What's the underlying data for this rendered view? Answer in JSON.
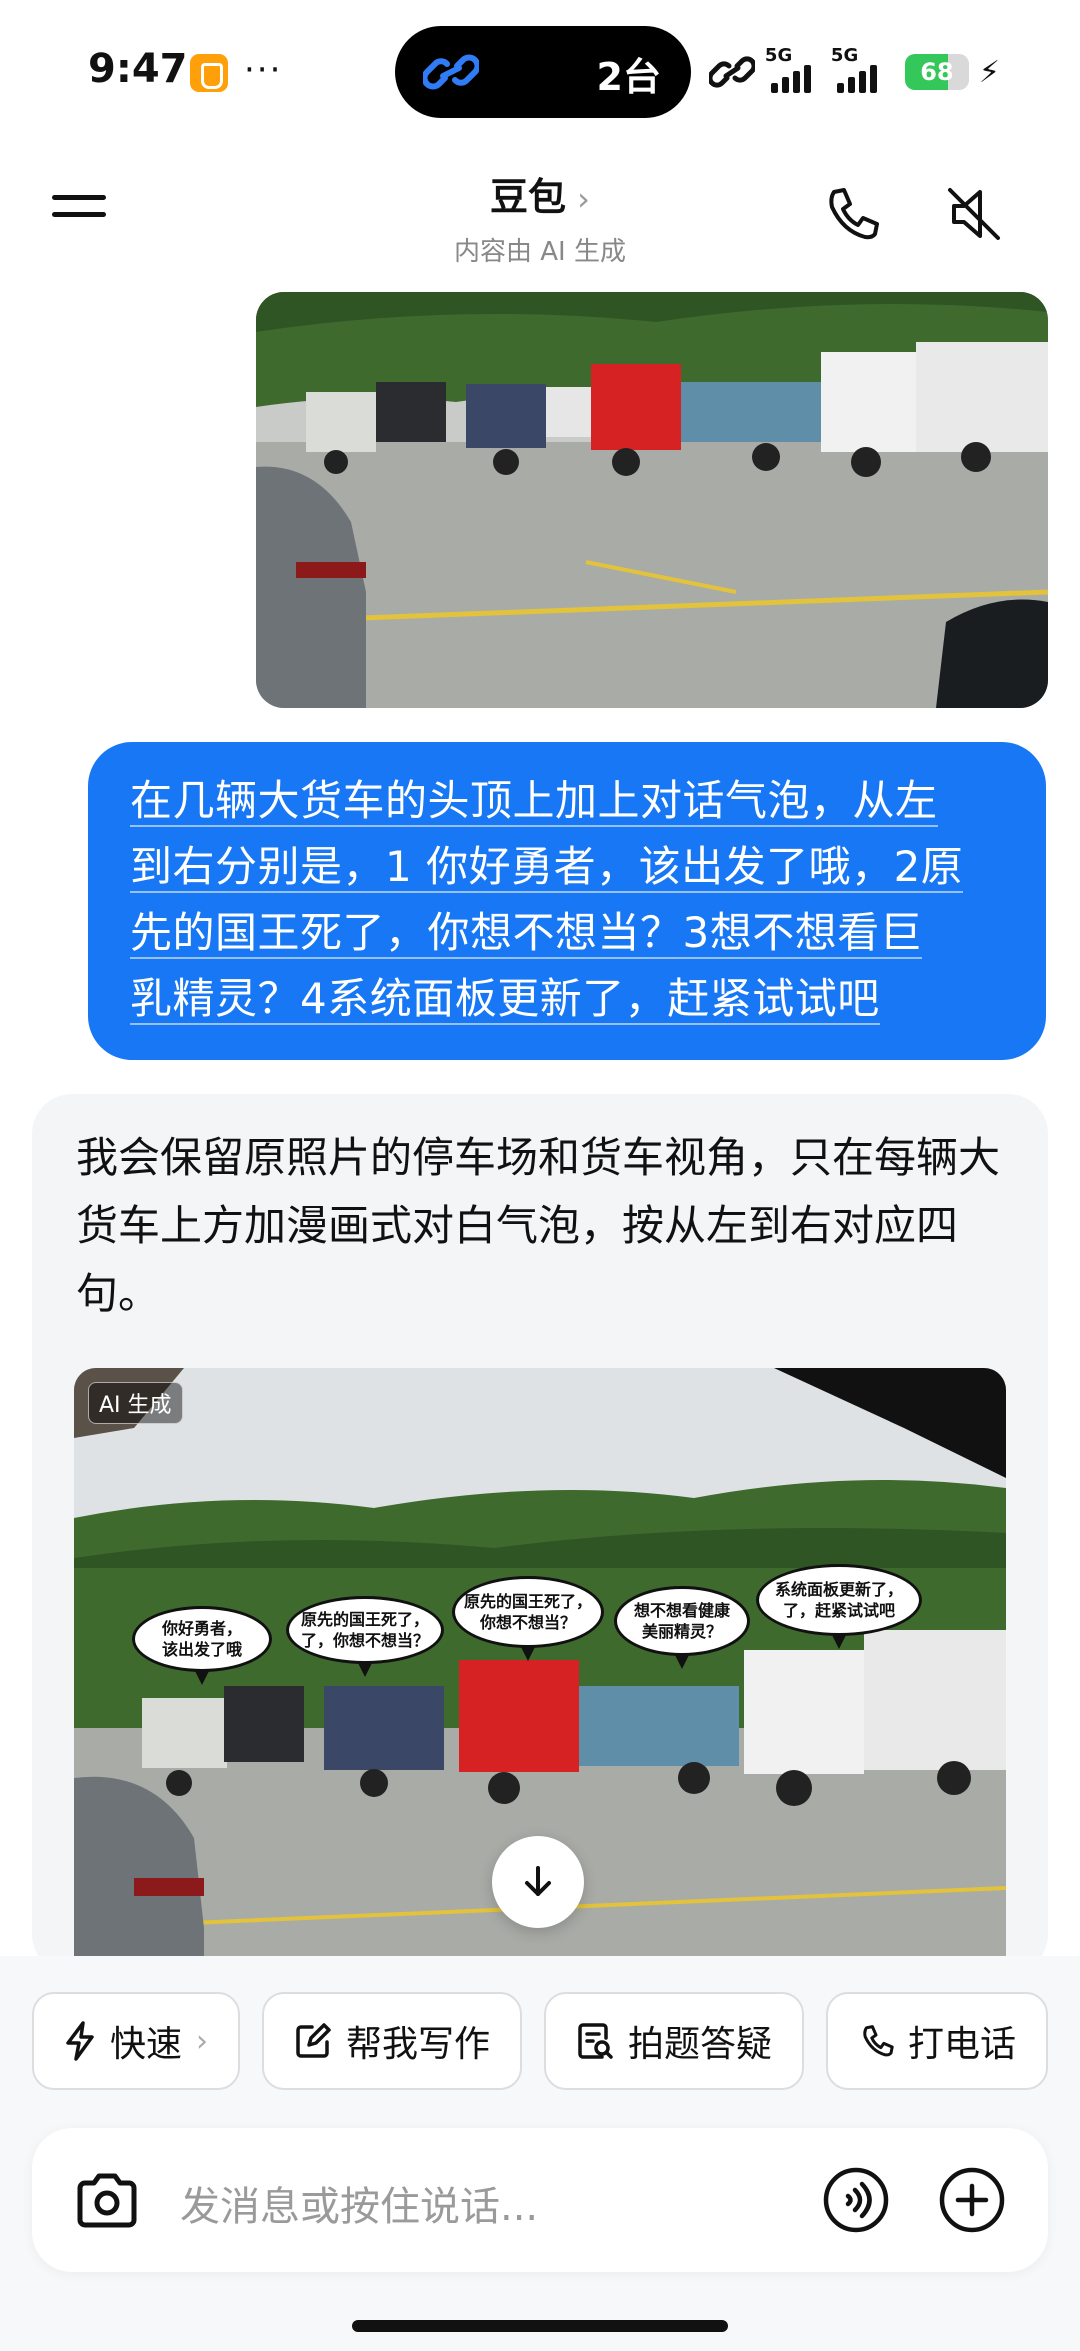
{
  "status_bar": {
    "time": "9:47",
    "dots": "···",
    "island_text": "2台",
    "sig1_tag": "5G",
    "sig2_tag": "5G",
    "battery": "68",
    "battery_level": 0.68
  },
  "header": {
    "title": "豆包",
    "title_chevron": "›",
    "subtitle": "内容由 AI 生成"
  },
  "messages": {
    "user_text_lines": [
      "在几辆大货车的头顶上加上对话气泡，从左",
      "到右分别是，1 你好勇者，该出发了哦，2原",
      "先的国王死了，你想不想当？3想不想看巨",
      "乳精灵？4系统面板更新了，赶紧试试吧"
    ],
    "bot_text": "我会保留原照片的停车场和货车视角，只在每辆大货车上方加漫画式对白气泡，按从左到右对应四句。",
    "ai_badge": "AI 生成",
    "speech_bubbles": [
      "你好勇者，\n该出发了哦",
      "原先的国王死了，\n了，你想不想当？",
      "原先的国王死了，\n你想不想当？",
      "想不想看健康\n美丽精灵？",
      "系统面板更新了，\n了，赶紧试试吧"
    ]
  },
  "chips": [
    {
      "label": "快速",
      "icon": "lightning-icon",
      "chevron": "›"
    },
    {
      "label": "帮我写作",
      "icon": "edit-icon"
    },
    {
      "label": "拍题答疑",
      "icon": "scan-doc-icon"
    },
    {
      "label": "打电话",
      "icon": "phone-icon"
    }
  ],
  "input": {
    "placeholder": "发消息或按住说话..."
  }
}
